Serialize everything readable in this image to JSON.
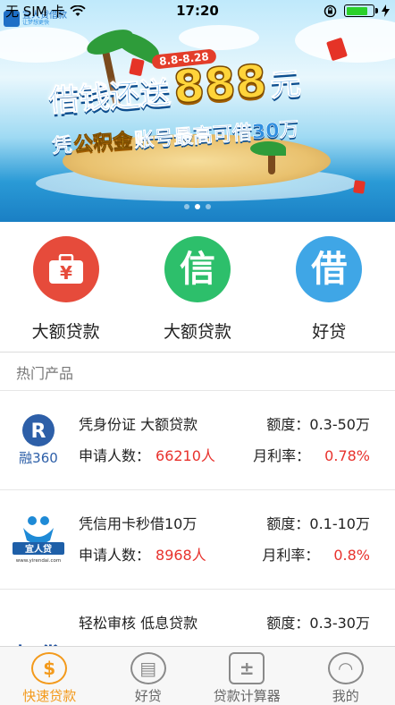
{
  "status_bar": {
    "carrier": "无 SIM 卡",
    "time": "17:20"
  },
  "banner": {
    "brand": "宜人贷借款",
    "brand_sub": "让梦想更快",
    "date_range": "8.8-8.28",
    "headline_part1": "借钱还送",
    "headline_amount": "888",
    "headline_unit": "元",
    "sub_part1": "凭",
    "sub_part2": "公积金",
    "sub_part3": "账号最高可借30万",
    "page_count": 3,
    "active_page": 2
  },
  "quick_entries": [
    {
      "label": "大额贷款",
      "icon": "yen-briefcase-icon",
      "glyph": "¥",
      "color": "#e64b3b"
    },
    {
      "label": "大额贷款",
      "icon": "credit-xin-icon",
      "glyph": "信",
      "color": "#2dbf6b"
    },
    {
      "label": "好贷",
      "icon": "borrow-jie-icon",
      "glyph": "借",
      "color": "#3fa6e6"
    }
  ],
  "hot_products": {
    "title": "热门产品",
    "items": [
      {
        "logo_text": "融360",
        "name": "凭身份证 大额贷款",
        "apply_label": "申请人数：",
        "apply_count": "66210人",
        "quota_label": "额度：",
        "quota": "0.3-50万",
        "rate_label": "月利率：",
        "rate": "0.78%"
      },
      {
        "logo_text": "宜人贷",
        "logo_sub": "www.yirendai.com",
        "name": "凭信用卡秒借10万",
        "apply_label": "申请人数：",
        "apply_count": "8968人",
        "quota_label": "额度：",
        "quota": "0.1-10万",
        "rate_label": "月利率：",
        "rate": "0.8%"
      },
      {
        "logo_text": "好贷",
        "name": "轻松审核 低息贷款",
        "quota_label": "额度：",
        "quota": "0.3-30万"
      }
    ]
  },
  "tab_bar": {
    "tabs": [
      {
        "label": "快速贷款",
        "icon": "dollar-icon",
        "glyph": "$",
        "active": true
      },
      {
        "label": "好贷",
        "icon": "document-icon",
        "glyph": "▤",
        "active": false
      },
      {
        "label": "贷款计算器",
        "icon": "calculator-icon",
        "glyph": "±",
        "active": false
      },
      {
        "label": "我的",
        "icon": "user-icon",
        "glyph": "◠",
        "active": false
      }
    ],
    "active_color": "#f39a1c"
  }
}
